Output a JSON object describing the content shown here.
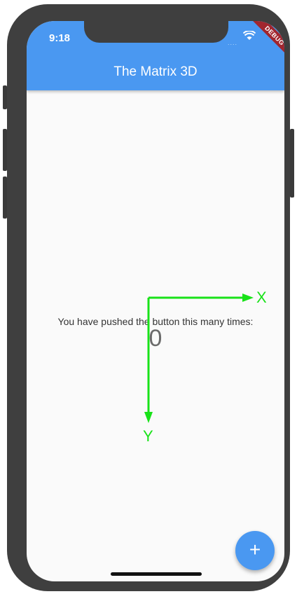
{
  "status_bar": {
    "time": "9:18"
  },
  "debug_banner": "DEBUG",
  "app_bar": {
    "title": "The Matrix 3D"
  },
  "main": {
    "message": "You have pushed the button this many times:",
    "counter": "0"
  },
  "axes": {
    "x_label": "X",
    "y_label": "Y",
    "color": "#19e219"
  },
  "fab": {
    "icon": "plus-icon",
    "label": "+"
  },
  "colors": {
    "primary": "#4a98f1",
    "frame": "#3f3f3f",
    "background": "#fafafa"
  }
}
